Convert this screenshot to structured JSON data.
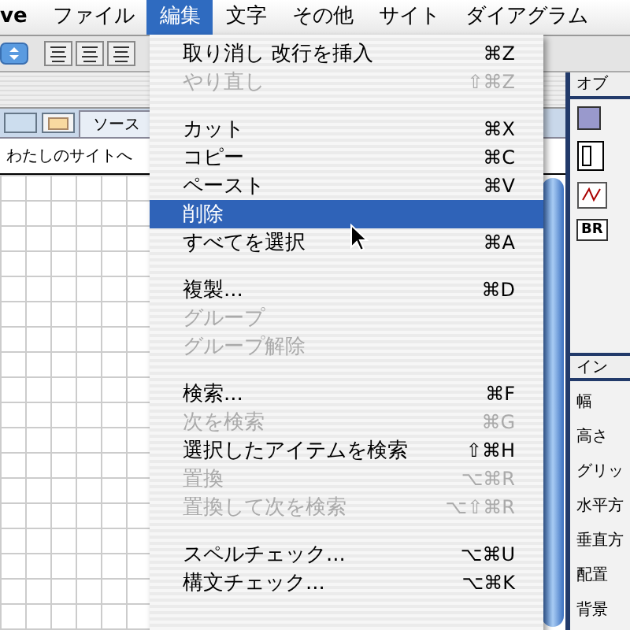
{
  "menu_bar": {
    "items": [
      {
        "label": "ve",
        "selected": false
      },
      {
        "label": "ファイル",
        "selected": false
      },
      {
        "label": "編集",
        "selected": true
      },
      {
        "label": "文字",
        "selected": false
      },
      {
        "label": "その他",
        "selected": false
      },
      {
        "label": "サイト",
        "selected": false
      },
      {
        "label": "ダイアグラム",
        "selected": false
      }
    ]
  },
  "document": {
    "tabs": [
      {
        "label": "ソース",
        "selected": false
      }
    ],
    "link_text": "わたしのサイトへ"
  },
  "right_panel": {
    "palette_title": "オブ",
    "tile_label": "BR",
    "inspector_title": "イン",
    "properties": [
      "幅",
      "高さ",
      "グリッ",
      "水平方",
      "垂直方",
      "配置",
      "背景"
    ]
  },
  "edit_menu": {
    "items": [
      {
        "kind": "item",
        "label": "取り消し 改行を挿入",
        "shortcut": "⌘Z",
        "disabled": false,
        "selected": false
      },
      {
        "kind": "item",
        "label": "やり直し",
        "shortcut": "⇧⌘Z",
        "disabled": true,
        "selected": false
      },
      {
        "kind": "separator"
      },
      {
        "kind": "item",
        "label": "カット",
        "shortcut": "⌘X",
        "disabled": false,
        "selected": false
      },
      {
        "kind": "item",
        "label": "コピー",
        "shortcut": "⌘C",
        "disabled": false,
        "selected": false
      },
      {
        "kind": "item",
        "label": "ペースト",
        "shortcut": "⌘V",
        "disabled": false,
        "selected": false
      },
      {
        "kind": "item",
        "label": "削除",
        "disabled": false,
        "selected": true
      },
      {
        "kind": "item",
        "label": "すべてを選択",
        "shortcut": "⌘A",
        "disabled": false,
        "selected": false
      },
      {
        "kind": "separator"
      },
      {
        "kind": "item",
        "label": "複製...",
        "shortcut": "⌘D",
        "disabled": false,
        "selected": false
      },
      {
        "kind": "item",
        "label": "グループ",
        "disabled": true,
        "selected": false
      },
      {
        "kind": "item",
        "label": "グループ解除",
        "disabled": true,
        "selected": false
      },
      {
        "kind": "separator"
      },
      {
        "kind": "item",
        "label": "検索...",
        "shortcut": "⌘F",
        "disabled": false,
        "selected": false
      },
      {
        "kind": "item",
        "label": "次を検索",
        "shortcut": "⌘G",
        "disabled": true,
        "selected": false
      },
      {
        "kind": "item",
        "label": "選択したアイテムを検索",
        "shortcut": "⇧⌘H",
        "disabled": false,
        "selected": false
      },
      {
        "kind": "item",
        "label": "置換",
        "shortcut": "⌥⌘R",
        "disabled": true,
        "selected": false
      },
      {
        "kind": "item",
        "label": "置換して次を検索",
        "shortcut": "⌥⇧⌘R",
        "disabled": true,
        "selected": false
      },
      {
        "kind": "separator"
      },
      {
        "kind": "item",
        "label": "スペルチェック...",
        "shortcut": "⌥⌘U",
        "disabled": false,
        "selected": false
      },
      {
        "kind": "item",
        "label": "構文チェック...",
        "shortcut": "⌥⌘K",
        "disabled": false,
        "selected": false
      }
    ]
  }
}
